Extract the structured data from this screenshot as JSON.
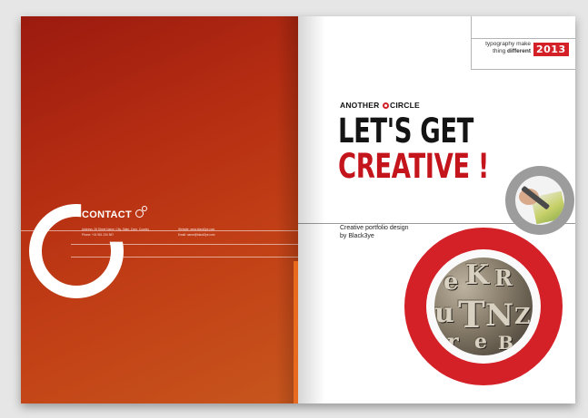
{
  "left_page": {
    "contact_title": "CONTACT",
    "contact_line_1": "Address: 26 Street Name, City, State, Zone, Country",
    "contact_line_2": "Phone: +01 961 234 567",
    "contact_line_3": "Website: www.black3ye.com",
    "contact_line_4": "Email: name@black3ye.com"
  },
  "right_page": {
    "tag_line_1": "typography make",
    "tag_line_2_plain": "thing ",
    "tag_line_2_bold": "different",
    "year": "2013",
    "brand_part_1": "ANOTHER",
    "brand_part_2": "CIRCLE",
    "headline_1": "LET'S GET",
    "headline_2": "CREATIVE !",
    "subtitle": "Creative portfolio design\nby Black3ye"
  },
  "colors": {
    "accent_red": "#d42027",
    "left_page_orange": "#c24016",
    "ring_gray": "#9c9c9c"
  },
  "icons": {
    "contact_icon": "circle-link-icon",
    "brand_icon": "red-circle-icon"
  }
}
